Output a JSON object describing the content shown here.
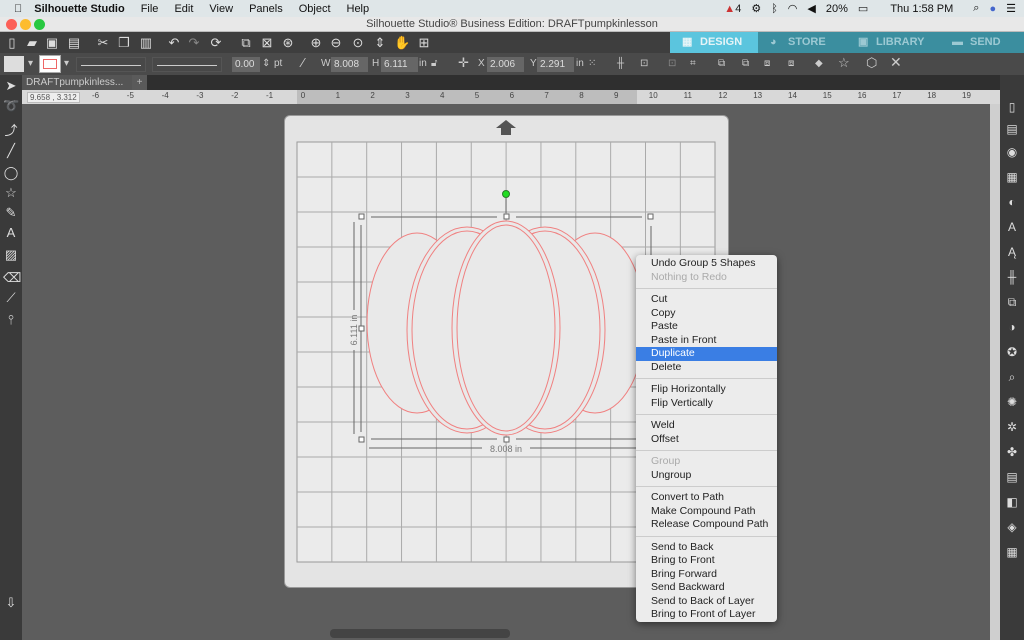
{
  "menubar": {
    "app": "Silhouette Studio",
    "items": [
      "File",
      "Edit",
      "View",
      "Panels",
      "Object",
      "Help"
    ],
    "battery": "20%",
    "clock": "Thu 1:58 PM",
    "badge_count": "4"
  },
  "window": {
    "title": "Silhouette Studio® Business Edition: DRAFTpumpkinlesson"
  },
  "nav_tabs": [
    {
      "label": "DESIGN",
      "active": true
    },
    {
      "label": "STORE"
    },
    {
      "label": "LIBRARY"
    },
    {
      "label": "SEND"
    }
  ],
  "colors": {
    "design_tab": "#5bc5de",
    "nav_tab": "#3b8e9f",
    "highlight": "#3a7ee4",
    "cut_line": "#f08080"
  },
  "toolbar2": {
    "line_weight": "0.00",
    "line_unit": "pt",
    "w_label": "W",
    "width": "8.008",
    "h_label": "H",
    "height": "6.111",
    "size_unit": "in",
    "x_label": "X",
    "x": "2.006",
    "y_label": "Y",
    "y": "2.291",
    "pos_unit": "in"
  },
  "document_tab": {
    "label": "DRAFTpumpkinless...",
    "close": "×",
    "add": "+"
  },
  "ruler": {
    "coords": "9.658 , 3.312",
    "ticks": [
      "-6",
      "-5",
      "-4",
      "-3",
      "-2",
      "-1",
      "0",
      "1",
      "2",
      "3",
      "4",
      "5",
      "6",
      "7",
      "8",
      "9",
      "10",
      "11",
      "12",
      "13",
      "14",
      "15",
      "16",
      "17",
      "18",
      "19"
    ]
  },
  "selection": {
    "width_label": "8.008 in",
    "height_label": "6.111 in"
  },
  "context_menu": {
    "groups": [
      [
        {
          "label": "Undo Group 5 Shapes"
        },
        {
          "label": "Nothing to Redo",
          "disabled": true
        }
      ],
      [
        {
          "label": "Cut"
        },
        {
          "label": "Copy"
        },
        {
          "label": "Paste"
        },
        {
          "label": "Paste in Front"
        },
        {
          "label": "Duplicate",
          "highlighted": true
        },
        {
          "label": "Delete"
        }
      ],
      [
        {
          "label": "Flip Horizontally"
        },
        {
          "label": "Flip Vertically"
        }
      ],
      [
        {
          "label": "Weld"
        },
        {
          "label": "Offset"
        }
      ],
      [
        {
          "label": "Group",
          "disabled": true
        },
        {
          "label": "Ungroup"
        }
      ],
      [
        {
          "label": "Convert to Path"
        },
        {
          "label": "Make Compound Path"
        },
        {
          "label": "Release Compound Path"
        }
      ],
      [
        {
          "label": "Send to Back"
        },
        {
          "label": "Bring to Front"
        },
        {
          "label": "Bring Forward"
        },
        {
          "label": "Send Backward"
        },
        {
          "label": "Send to Back of Layer"
        },
        {
          "label": "Bring to Front of Layer"
        }
      ]
    ]
  }
}
